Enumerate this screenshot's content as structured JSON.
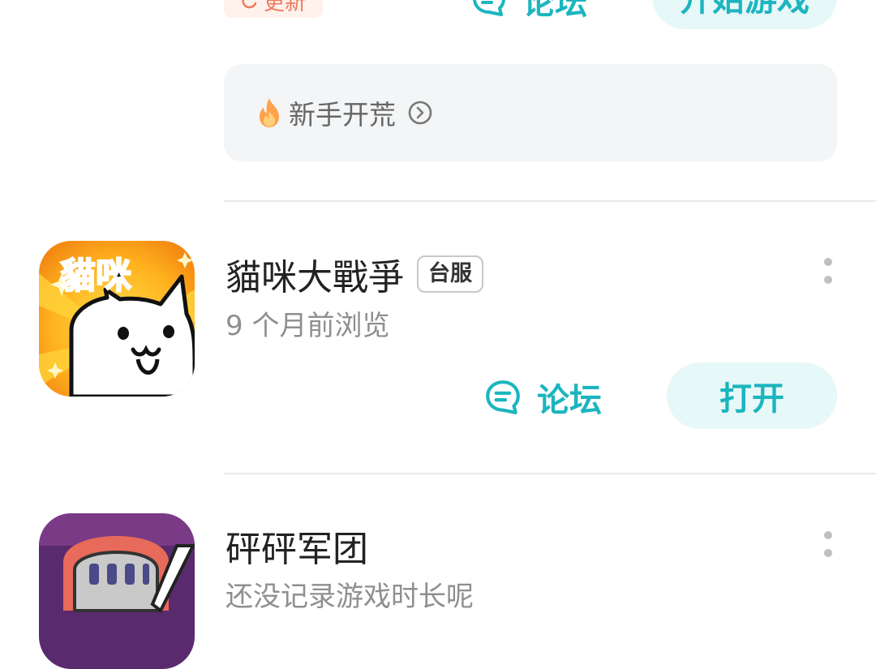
{
  "top_row": {
    "badge_label": "更新",
    "forum_label": "论坛",
    "action_label": "开始游戏"
  },
  "tips": {
    "label": "新手开荒"
  },
  "games": [
    {
      "title": "貓咪大戰爭",
      "tag": "台服",
      "subtitle": "9 个月前浏览",
      "forum_label": "论坛",
      "action_label": "打开",
      "icon_text": "貓咪"
    },
    {
      "title": "砰砰军团",
      "subtitle": "还没记录游戏时长呢"
    }
  ],
  "colors": {
    "accent": "#1cb5bf",
    "accent_bg": "#e7f8f8",
    "badge_text": "#f07a5c",
    "badge_bg": "#fff1ec"
  }
}
